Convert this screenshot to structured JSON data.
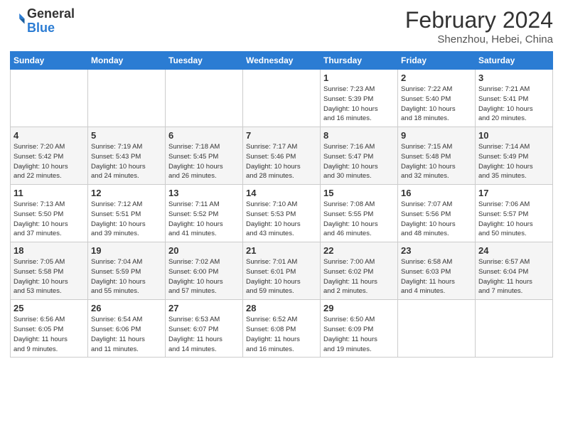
{
  "header": {
    "logo_line1": "General",
    "logo_line2": "Blue",
    "month": "February 2024",
    "location": "Shenzhou, Hebei, China"
  },
  "days_of_week": [
    "Sunday",
    "Monday",
    "Tuesday",
    "Wednesday",
    "Thursday",
    "Friday",
    "Saturday"
  ],
  "weeks": [
    [
      {
        "num": "",
        "info": ""
      },
      {
        "num": "",
        "info": ""
      },
      {
        "num": "",
        "info": ""
      },
      {
        "num": "",
        "info": ""
      },
      {
        "num": "1",
        "info": "Sunrise: 7:23 AM\nSunset: 5:39 PM\nDaylight: 10 hours\nand 16 minutes."
      },
      {
        "num": "2",
        "info": "Sunrise: 7:22 AM\nSunset: 5:40 PM\nDaylight: 10 hours\nand 18 minutes."
      },
      {
        "num": "3",
        "info": "Sunrise: 7:21 AM\nSunset: 5:41 PM\nDaylight: 10 hours\nand 20 minutes."
      }
    ],
    [
      {
        "num": "4",
        "info": "Sunrise: 7:20 AM\nSunset: 5:42 PM\nDaylight: 10 hours\nand 22 minutes."
      },
      {
        "num": "5",
        "info": "Sunrise: 7:19 AM\nSunset: 5:43 PM\nDaylight: 10 hours\nand 24 minutes."
      },
      {
        "num": "6",
        "info": "Sunrise: 7:18 AM\nSunset: 5:45 PM\nDaylight: 10 hours\nand 26 minutes."
      },
      {
        "num": "7",
        "info": "Sunrise: 7:17 AM\nSunset: 5:46 PM\nDaylight: 10 hours\nand 28 minutes."
      },
      {
        "num": "8",
        "info": "Sunrise: 7:16 AM\nSunset: 5:47 PM\nDaylight: 10 hours\nand 30 minutes."
      },
      {
        "num": "9",
        "info": "Sunrise: 7:15 AM\nSunset: 5:48 PM\nDaylight: 10 hours\nand 32 minutes."
      },
      {
        "num": "10",
        "info": "Sunrise: 7:14 AM\nSunset: 5:49 PM\nDaylight: 10 hours\nand 35 minutes."
      }
    ],
    [
      {
        "num": "11",
        "info": "Sunrise: 7:13 AM\nSunset: 5:50 PM\nDaylight: 10 hours\nand 37 minutes."
      },
      {
        "num": "12",
        "info": "Sunrise: 7:12 AM\nSunset: 5:51 PM\nDaylight: 10 hours\nand 39 minutes."
      },
      {
        "num": "13",
        "info": "Sunrise: 7:11 AM\nSunset: 5:52 PM\nDaylight: 10 hours\nand 41 minutes."
      },
      {
        "num": "14",
        "info": "Sunrise: 7:10 AM\nSunset: 5:53 PM\nDaylight: 10 hours\nand 43 minutes."
      },
      {
        "num": "15",
        "info": "Sunrise: 7:08 AM\nSunset: 5:55 PM\nDaylight: 10 hours\nand 46 minutes."
      },
      {
        "num": "16",
        "info": "Sunrise: 7:07 AM\nSunset: 5:56 PM\nDaylight: 10 hours\nand 48 minutes."
      },
      {
        "num": "17",
        "info": "Sunrise: 7:06 AM\nSunset: 5:57 PM\nDaylight: 10 hours\nand 50 minutes."
      }
    ],
    [
      {
        "num": "18",
        "info": "Sunrise: 7:05 AM\nSunset: 5:58 PM\nDaylight: 10 hours\nand 53 minutes."
      },
      {
        "num": "19",
        "info": "Sunrise: 7:04 AM\nSunset: 5:59 PM\nDaylight: 10 hours\nand 55 minutes."
      },
      {
        "num": "20",
        "info": "Sunrise: 7:02 AM\nSunset: 6:00 PM\nDaylight: 10 hours\nand 57 minutes."
      },
      {
        "num": "21",
        "info": "Sunrise: 7:01 AM\nSunset: 6:01 PM\nDaylight: 10 hours\nand 59 minutes."
      },
      {
        "num": "22",
        "info": "Sunrise: 7:00 AM\nSunset: 6:02 PM\nDaylight: 11 hours\nand 2 minutes."
      },
      {
        "num": "23",
        "info": "Sunrise: 6:58 AM\nSunset: 6:03 PM\nDaylight: 11 hours\nand 4 minutes."
      },
      {
        "num": "24",
        "info": "Sunrise: 6:57 AM\nSunset: 6:04 PM\nDaylight: 11 hours\nand 7 minutes."
      }
    ],
    [
      {
        "num": "25",
        "info": "Sunrise: 6:56 AM\nSunset: 6:05 PM\nDaylight: 11 hours\nand 9 minutes."
      },
      {
        "num": "26",
        "info": "Sunrise: 6:54 AM\nSunset: 6:06 PM\nDaylight: 11 hours\nand 11 minutes."
      },
      {
        "num": "27",
        "info": "Sunrise: 6:53 AM\nSunset: 6:07 PM\nDaylight: 11 hours\nand 14 minutes."
      },
      {
        "num": "28",
        "info": "Sunrise: 6:52 AM\nSunset: 6:08 PM\nDaylight: 11 hours\nand 16 minutes."
      },
      {
        "num": "29",
        "info": "Sunrise: 6:50 AM\nSunset: 6:09 PM\nDaylight: 11 hours\nand 19 minutes."
      },
      {
        "num": "",
        "info": ""
      },
      {
        "num": "",
        "info": ""
      }
    ]
  ]
}
